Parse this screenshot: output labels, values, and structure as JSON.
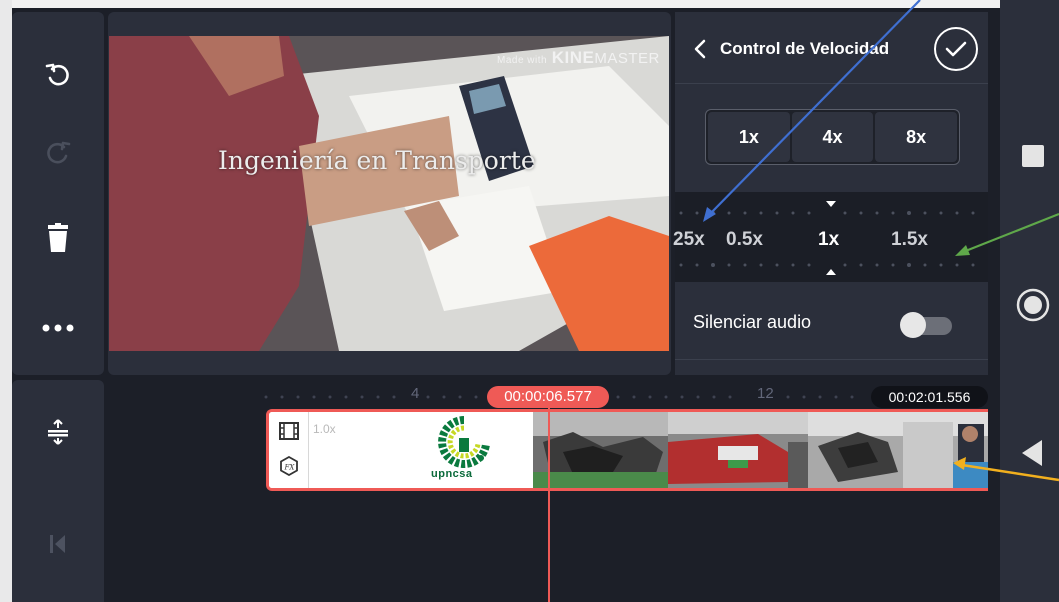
{
  "preview": {
    "watermark_prefix": "Made with",
    "watermark_brand_bold": "KINE",
    "watermark_brand_light": "MASTER",
    "overlay_title": "Ingeniería en Transporte"
  },
  "panel": {
    "title": "Control de Velocidad",
    "presets": [
      "1x",
      "4x",
      "8x"
    ],
    "speed_labels": [
      "25x",
      "0.5x",
      "1x",
      "1.5x"
    ],
    "silence_label": "Silenciar audio",
    "silence_on": false
  },
  "timeline": {
    "ruler_numbers": [
      "4",
      "12"
    ],
    "current_time": "00:00:06.577",
    "total_time": "00:02:01.556",
    "clip_speed": "1.0x",
    "logo_text": "upncsa"
  },
  "colors": {
    "accent": "#ef5a56",
    "panel": "#2b2f3b",
    "background": "#1c1f28",
    "annotation_blue": "#3f6fd1",
    "annotation_green": "#5fa84a",
    "annotation_orange": "#f2b01e"
  },
  "icons": {
    "undo": "undo-icon",
    "redo": "redo-icon",
    "delete": "trash-icon",
    "more": "more-icon",
    "split": "split-icon",
    "jump_start": "jump-to-start-icon",
    "stop": "stop-icon",
    "record": "record-icon",
    "back": "back-triangle-icon"
  }
}
